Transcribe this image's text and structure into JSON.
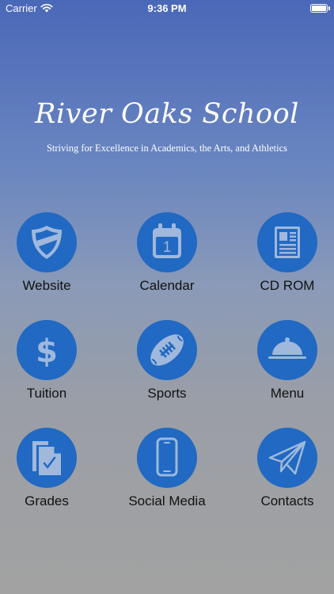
{
  "status_bar": {
    "carrier": "Carrier",
    "time": "9:36 PM"
  },
  "header": {
    "title": "River Oaks School",
    "tagline": "Striving for Excellence in Academics, the Arts, and Athletics"
  },
  "tiles": [
    {
      "label": "Website",
      "icon": "shield-icon"
    },
    {
      "label": "Calendar",
      "icon": "calendar-icon",
      "icon_text": "1"
    },
    {
      "label": "CD ROM",
      "icon": "document-icon"
    },
    {
      "label": "Tuition",
      "icon": "dollar-icon",
      "icon_text": "$"
    },
    {
      "label": "Sports",
      "icon": "football-icon"
    },
    {
      "label": "Menu",
      "icon": "cloche-icon"
    },
    {
      "label": "Grades",
      "icon": "grades-icon"
    },
    {
      "label": "Social Media",
      "icon": "phone-icon"
    },
    {
      "label": "Contacts",
      "icon": "paper-plane-icon"
    }
  ],
  "colors": {
    "icon_circle": "#2169c2",
    "gradient_top": "#4a68b8",
    "gradient_bottom": "#a2a2a2"
  }
}
